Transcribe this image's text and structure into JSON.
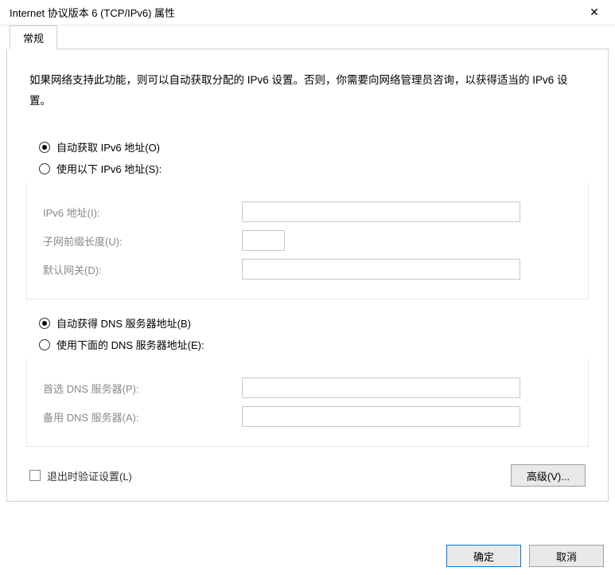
{
  "window": {
    "title": "Internet 协议版本 6 (TCP/IPv6) 属性"
  },
  "tab": {
    "general": "常规"
  },
  "description": "如果网络支持此功能，则可以自动获取分配的 IPv6 设置。否则，你需要向网络管理员咨询，以获得适当的 IPv6 设置。",
  "ipv6": {
    "auto_radio": "自动获取 IPv6 地址(O)",
    "manual_radio": "使用以下 IPv6 地址(S):",
    "addr_label": "IPv6 地址(I):",
    "prefix_label": "子网前缀长度(U):",
    "gateway_label": "默认网关(D):",
    "addr_value": "",
    "prefix_value": "",
    "gateway_value": ""
  },
  "dns": {
    "auto_radio": "自动获得 DNS 服务器地址(B)",
    "manual_radio": "使用下面的 DNS 服务器地址(E):",
    "preferred_label": "首选 DNS 服务器(P):",
    "alternate_label": "备用 DNS 服务器(A):",
    "preferred_value": "",
    "alternate_value": ""
  },
  "validate_checkbox": "退出时验证设置(L)",
  "buttons": {
    "advanced": "高级(V)...",
    "ok": "确定",
    "cancel": "取消"
  }
}
